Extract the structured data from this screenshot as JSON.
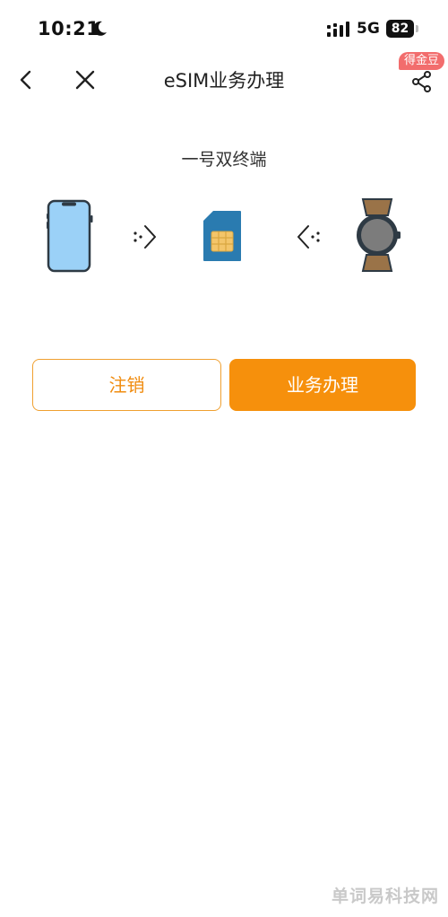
{
  "status_bar": {
    "time": "10:21",
    "network": "5G",
    "battery": "82"
  },
  "nav": {
    "title": "eSIM业务办理",
    "coin_badge": "得金豆"
  },
  "content": {
    "subtitle": "一号双终端"
  },
  "buttons": {
    "cancel_label": "注销",
    "apply_label": "业务办理"
  },
  "watermark": "单词易科技网",
  "colors": {
    "accent": "#f6900c",
    "badge": "#f26d6d",
    "sim": "#2a7bb0",
    "watch_strap": "#9a7348"
  }
}
